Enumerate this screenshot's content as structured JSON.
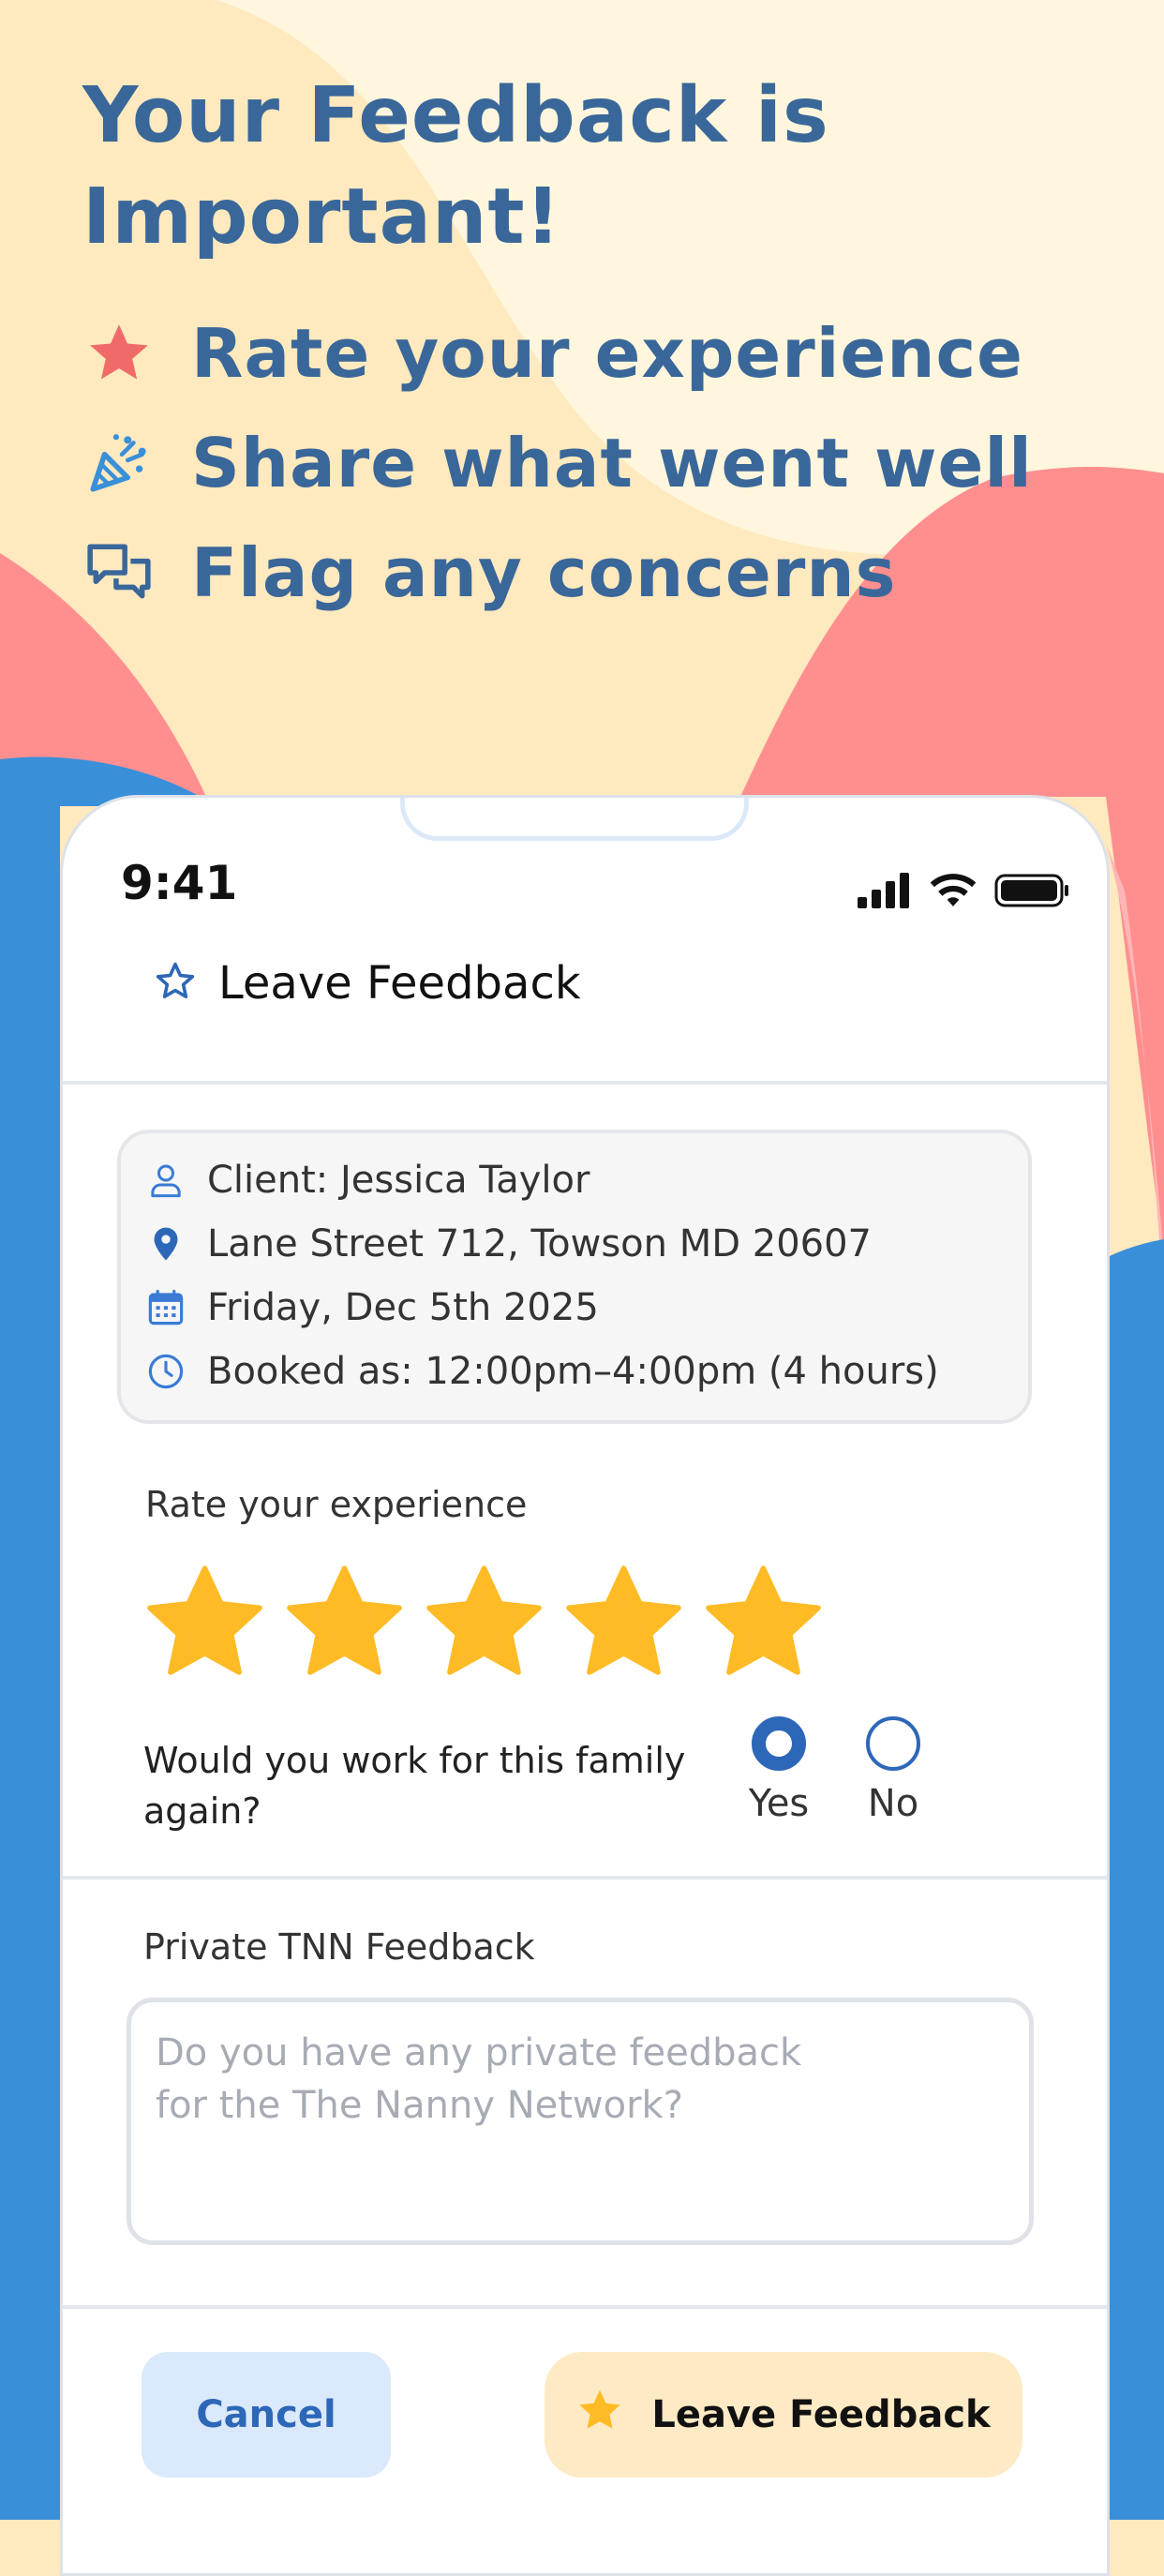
{
  "hero": {
    "title": "Your Feedback is Important!",
    "items": [
      {
        "icon": "star-icon",
        "text": "Rate your experience"
      },
      {
        "icon": "party-popper-icon",
        "text": "Share what went well"
      },
      {
        "icon": "chat-bubbles-icon",
        "text": "Flag any concerns"
      }
    ]
  },
  "status_bar": {
    "time": "9:41"
  },
  "header": {
    "title": "Leave Feedback",
    "icon": "star-outline-icon"
  },
  "booking": {
    "client": "Client: Jessica Taylor",
    "address": "Lane Street 712, Towson MD 20607",
    "date": "Friday, Dec 5th 2025",
    "booked": "Booked as: 12:00pm–4:00pm (4 hours)"
  },
  "rating": {
    "label": "Rate your experience",
    "value": 5,
    "max": 5
  },
  "work_again": {
    "question": "Would you work for this family again?",
    "options": [
      "Yes",
      "No"
    ],
    "selected": "Yes"
  },
  "private_feedback": {
    "label": "Private TNN Feedback",
    "placeholder": "Do you have any private feedback\nfor the The Nanny Network?"
  },
  "buttons": {
    "cancel": "Cancel",
    "submit": "Leave Feedback"
  },
  "colors": {
    "accent_blue": "#3a6799",
    "star_yellow": "#ffbb25",
    "background_cream": "#ffe9bf",
    "background_coral": "#ff8f8f",
    "background_blue": "#3a8fd9"
  }
}
